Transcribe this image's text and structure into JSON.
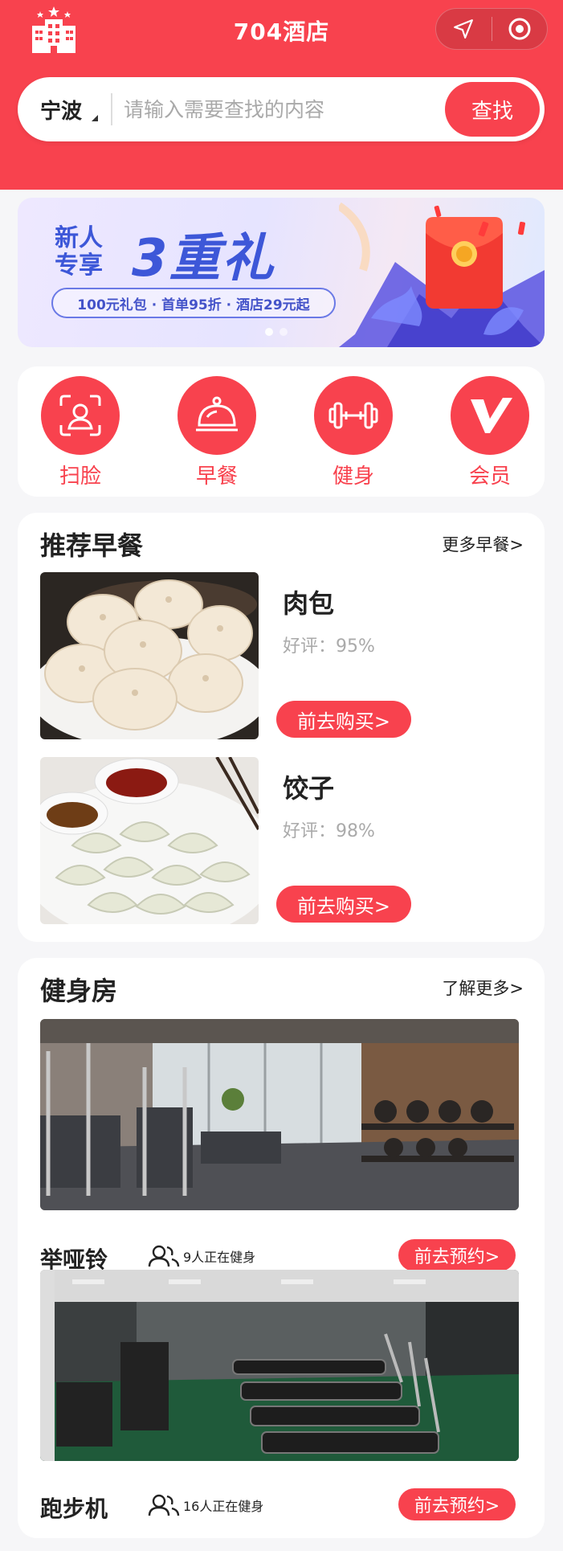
{
  "app": {
    "title": "704酒店"
  },
  "colors": {
    "primary": "#f8424e"
  },
  "header": {
    "logo_icon": "hotel-building-icon",
    "capsule": {
      "left_icon": "location-arrow-icon",
      "right_icon": "target-close-icon"
    }
  },
  "search": {
    "city": "宁波",
    "placeholder": "请输入需要查找的内容",
    "value": "",
    "button_label": "查找"
  },
  "banner": {
    "tag_line1": "新人",
    "tag_line2": "专享",
    "headline": "3重礼",
    "subline": "100元礼包 · 首单95折 · 酒店29元起",
    "slide_count": 2,
    "active_slide": 1
  },
  "quick_actions": [
    {
      "label": "扫脸",
      "icon": "face-scan-icon"
    },
    {
      "label": "早餐",
      "icon": "food-cloche-icon"
    },
    {
      "label": "健身",
      "icon": "dumbbell-icon"
    },
    {
      "label": "会员",
      "icon": "vip-v-icon"
    }
  ],
  "breakfast": {
    "title": "推荐早餐",
    "more_label": "更多早餐>",
    "items": [
      {
        "name": "肉包",
        "rating": "好评：95%",
        "button": "前去购买>",
        "image": "steamed-buns-photo"
      },
      {
        "name": "饺子",
        "rating": "好评：98%",
        "button": "前去购买>",
        "image": "dumplings-photo"
      }
    ]
  },
  "gym": {
    "title": "健身房",
    "more_label": "了解更多>",
    "items": [
      {
        "name": "举哑铃",
        "users": "9人正在健身",
        "button": "前去预约>",
        "image": "dumbbell-room-photo"
      },
      {
        "name": "跑步机",
        "users": "16人正在健身",
        "button": "前去预约>",
        "image": "treadmill-room-photo"
      }
    ]
  }
}
